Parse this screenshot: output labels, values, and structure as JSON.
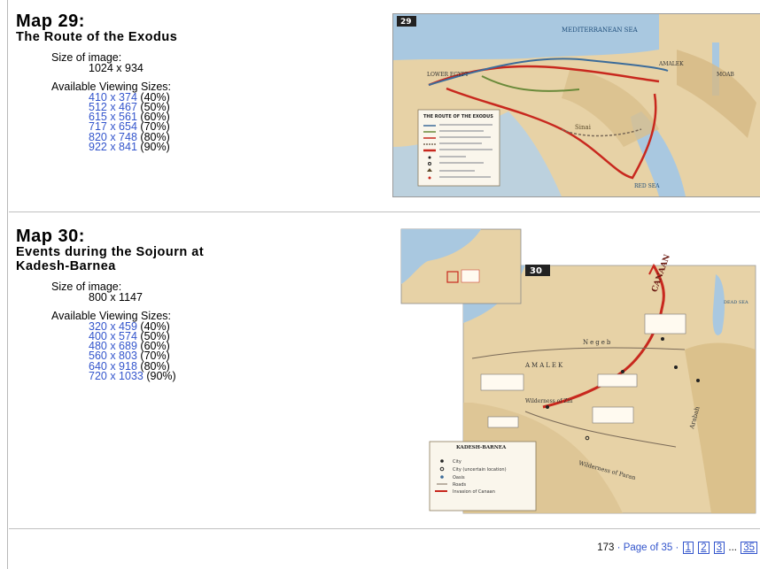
{
  "maps": [
    {
      "title": "Map 29:",
      "subtitle": "The Route of the Exodus",
      "size_label": "Size of image:",
      "size_value": "1024 x 934",
      "viewing_label": "Available Viewing Sizes:",
      "sizes": [
        {
          "link": "410 x 374",
          "pct": "(40%)"
        },
        {
          "link": "512 x 467",
          "pct": "(50%)"
        },
        {
          "link": "615 x 561",
          "pct": "(60%)"
        },
        {
          "link": "717 x 654",
          "pct": "(70%)"
        },
        {
          "link": "820 x 748",
          "pct": "(80%)"
        },
        {
          "link": "922 x 841",
          "pct": "(90%)"
        }
      ],
      "thumb": {
        "badge": "29",
        "sea_label": "MEDITERRANEAN SEA",
        "region_left": "LOWER EGYPT",
        "region_right": "AMALEK",
        "region_moab": "MOAB",
        "region_sinai": "Sinai",
        "legend_title": "THE ROUTE OF THE EXODUS",
        "red_sea_label": "RED SEA"
      }
    },
    {
      "title": "Map 30:",
      "subtitle_line1": "Events during the Sojourn at",
      "subtitle_line2": "Kadesh-Barnea",
      "size_label": "Size of image:",
      "size_value": "800 x 1147",
      "viewing_label": "Available Viewing Sizes:",
      "sizes": [
        {
          "link": "320 x 459",
          "pct": "(40%)"
        },
        {
          "link": "400 x 574",
          "pct": "(50%)"
        },
        {
          "link": "480 x 689",
          "pct": "(60%)"
        },
        {
          "link": "560 x 803",
          "pct": "(70%)"
        },
        {
          "link": "640 x 918",
          "pct": "(80%)"
        },
        {
          "link": "720 x 1033",
          "pct": "(90%)"
        }
      ],
      "thumb": {
        "badge": "30",
        "region_canaan": "CANAAN",
        "region_negeb": "Negeb",
        "region_amalek": "AMALEK",
        "region_zin": "Wilderness of Zin",
        "region_paran": "Wilderness of Paran",
        "dead_sea": "DEAD SEA",
        "arabah": "Arabah",
        "legend_title": "KADESH-BARNEA",
        "legend_items": [
          "City",
          "City (uncertain location)",
          "Oasis",
          "Roads",
          "Invasion of Canaan"
        ]
      }
    }
  ],
  "pager": {
    "count": "173",
    "page_label": "Page of 35",
    "pages": [
      "1",
      "2",
      "3"
    ],
    "ellipsis": "...",
    "last": "35"
  },
  "colors": {
    "link": "#3355cc",
    "route_red": "#c8281e",
    "sea_blue": "#a9c8e0",
    "land": "#e7d2a6"
  }
}
